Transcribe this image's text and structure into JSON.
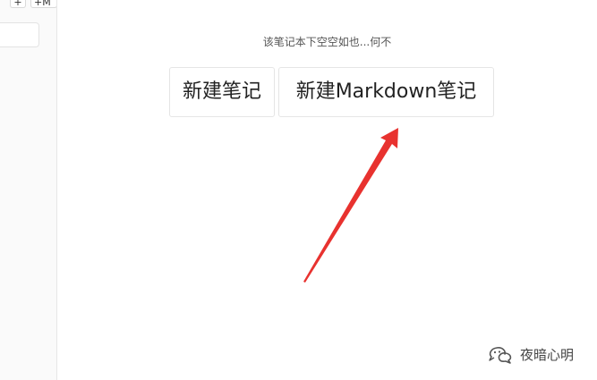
{
  "sidebar": {
    "add_label": "+",
    "add_markdown_label": "+M"
  },
  "main": {
    "empty_message": "该笔记本下空空如也...何不",
    "new_note_label": "新建笔记",
    "new_markdown_note_label": "新建Markdown笔记"
  },
  "annotation": {
    "arrow_color": "#e8322f"
  },
  "watermark": {
    "text": "夜暗心明",
    "icon": "wechat-icon"
  }
}
